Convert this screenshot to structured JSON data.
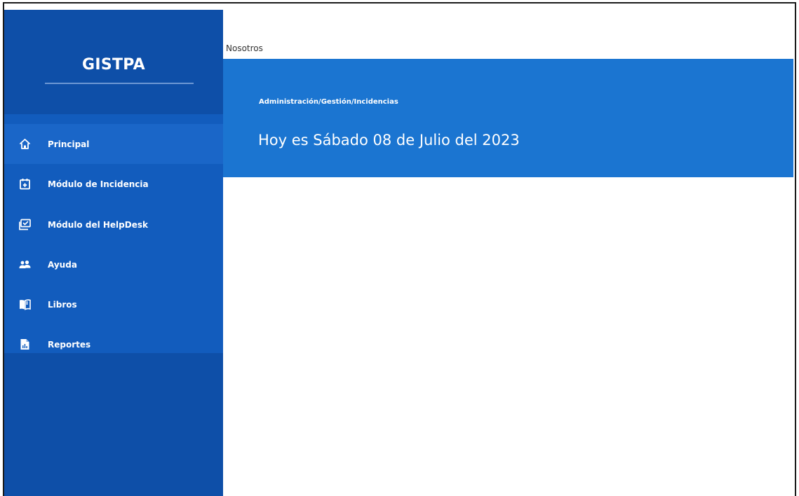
{
  "sidebar": {
    "brand": "GISTPA",
    "items": [
      {
        "label": "Principal",
        "icon": "home-icon",
        "active": true
      },
      {
        "label": "Módulo de Incidencia",
        "icon": "calendar-add-icon",
        "active": false
      },
      {
        "label": "Módulo del HelpDesk",
        "icon": "monitor-check-icon",
        "active": false
      },
      {
        "label": "Ayuda",
        "icon": "group-icon",
        "active": false
      },
      {
        "label": "Libros",
        "icon": "books-icon",
        "active": false
      },
      {
        "label": "Reportes",
        "icon": "report-file-icon",
        "active": false
      }
    ]
  },
  "topbar": {
    "link": "Nosotros"
  },
  "hero": {
    "breadcrumb": "Administración/Gestión/Incidencias",
    "date_text": "Hoy es Sábado 08 de Julio del 2023"
  },
  "colors": {
    "sidebar_bg": "#0e4fa8",
    "nav_bg": "#125cbd",
    "active_item_bg": "#1a66c8",
    "hero_bg": "#1b75d1",
    "text_on_blue": "#ffffff"
  }
}
